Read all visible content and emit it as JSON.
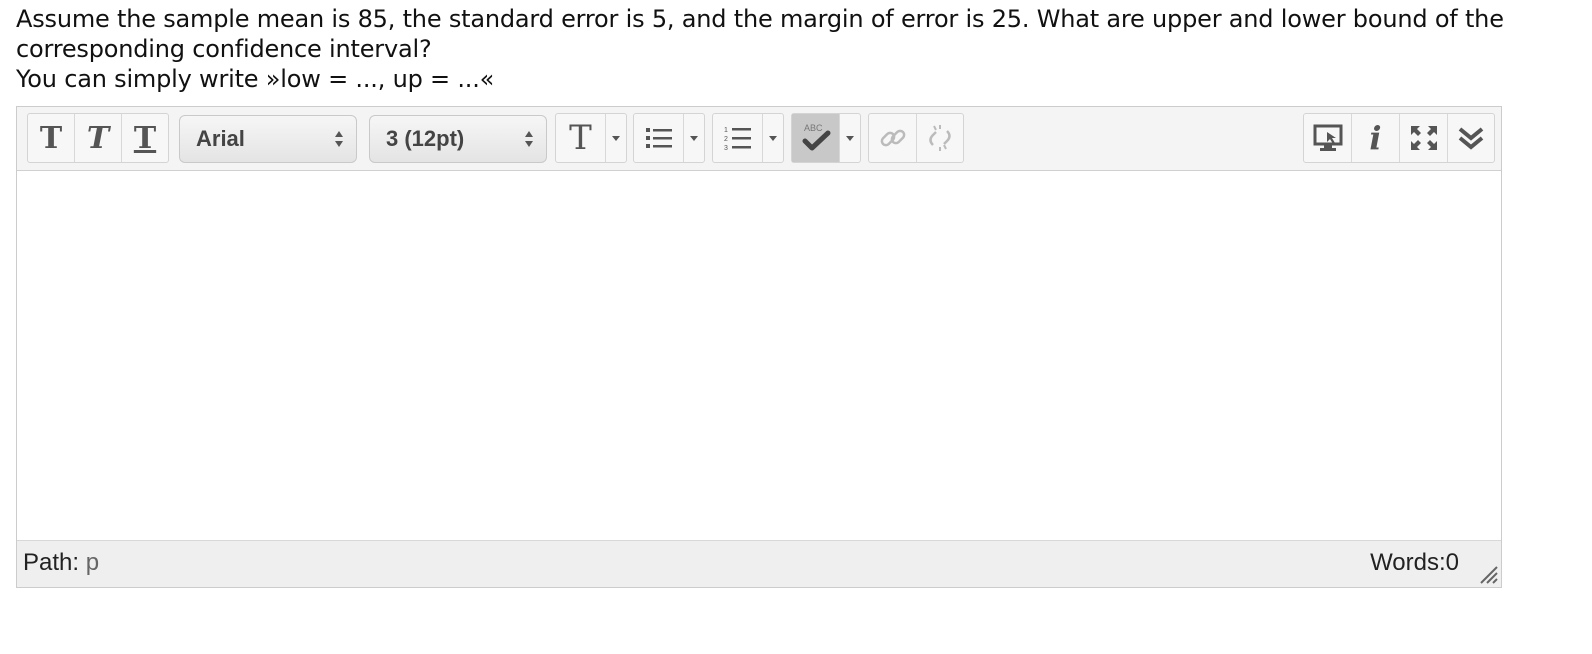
{
  "question": {
    "line1": "Assume the sample mean is 85, the standard error is 5, and the margin of error is 25. What are upper and lower bound of the corresponding confidence interval?",
    "line2": "You can simply write »low = ..., up = ...«"
  },
  "toolbar": {
    "format_buttons": [
      {
        "name": "bold-button",
        "glyph": "T"
      },
      {
        "name": "italic-button",
        "glyph": "T"
      },
      {
        "name": "underline-button",
        "glyph": "T"
      }
    ],
    "font_select": {
      "value": "Arial"
    },
    "size_select": {
      "value": "3 (12pt)"
    },
    "icons": [
      "text-color-icon",
      "bullet-list-icon",
      "numbered-list-icon",
      "spellcheck-icon",
      "link-icon",
      "unlink-icon",
      "preview-icon",
      "info-icon",
      "fullscreen-icon",
      "expand-toolbar-icon"
    ]
  },
  "status": {
    "path_label": "Path:",
    "path_value": "p",
    "words": "Words:0"
  },
  "colors": {
    "toolbar_bg": "#f4f4f4",
    "border": "#cccccc",
    "icon": "#555555"
  }
}
